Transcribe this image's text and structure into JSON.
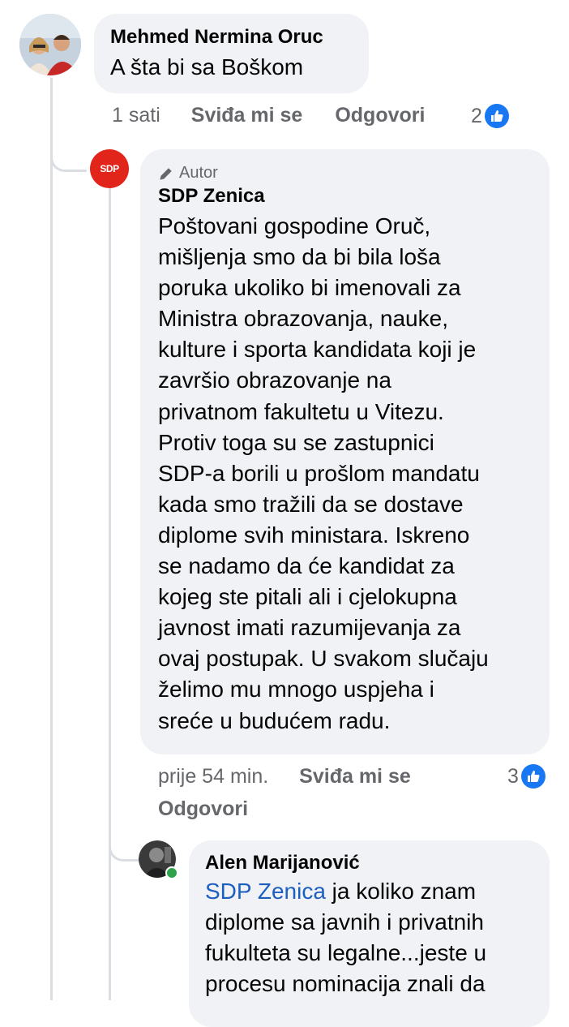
{
  "comment1": {
    "author": "Mehmed Nermina Oruc",
    "text": "A šta bi sa Boškom",
    "time": "1 sati",
    "like_label": "Sviđa mi se",
    "reply_label": "Odgovori",
    "reaction_count": "2"
  },
  "reply1": {
    "badge": "Autor",
    "author": "SDP Zenica",
    "avatar_text": "SDP",
    "lines": [
      "Poštovani gospodine Oruč,",
      "mišljenja smo da bi bila loša",
      "poruka ukoliko bi imenovali za",
      "Ministra obrazovanja, nauke,",
      "kulture i sporta kandidata koji je",
      "završio obrazovanje na",
      "privatnom fakultetu u Vitezu.",
      "Protiv toga su se zastupnici",
      "SDP-a borili u prošlom mandatu",
      "kada smo tražili da se dostave",
      "diplome svih ministara. Iskreno",
      "se nadamo da će kandidat za",
      "kojeg ste pitali ali i cjelokupna",
      "javnost imati razumijevanja za",
      "ovaj postupak. U svakom slučaju",
      "želimo mu mnogo uspjeha i",
      "sreće u budućem radu."
    ],
    "time": "prije 54 min.",
    "like_label": "Sviđa mi se",
    "reply_label": "Odgovori",
    "reaction_count": "3"
  },
  "reply2": {
    "author": "Alen Marijanović",
    "mention": "SDP Zenica",
    "first_line_rest": " ja koliko znam",
    "lines": [
      "diplome sa javnih i privatnih",
      "fukulteta su legalne...jeste u",
      "procesu nominacija znali da"
    ]
  },
  "colors": {
    "bubble": "#f0f2f5",
    "meta_text": "#65676b",
    "like_blue": "#1877f2",
    "mention_blue": "#1d5fbf",
    "sdp_red": "#e1251b",
    "online_green": "#31a24c"
  },
  "icons": [
    "like-icon",
    "pencil-icon",
    "online-dot"
  ]
}
